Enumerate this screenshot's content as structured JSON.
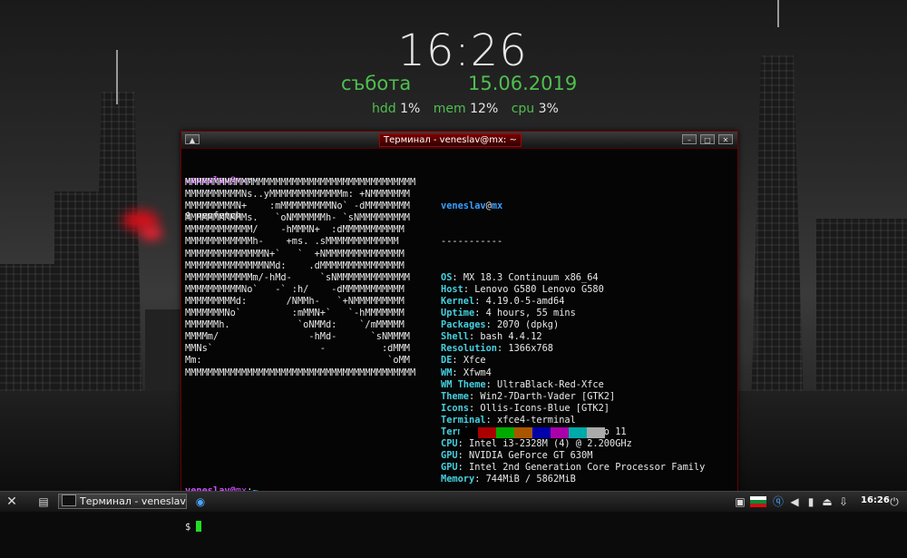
{
  "conky": {
    "time": "16:26",
    "weekday": "събота",
    "date": "15.06.2019",
    "stats": [
      {
        "label": "hdd",
        "value": "1%"
      },
      {
        "label": "mem",
        "value": "12%"
      },
      {
        "label": "cpu",
        "value": "3%"
      }
    ]
  },
  "terminal": {
    "title": "Терминал - veneslav@mx: ~",
    "prompt_user": "veneslav",
    "prompt_host": "mx",
    "prompt_path": "~",
    "command": "neofetch",
    "ascii_art": [
      "MMMMMMMMMMMMMMMMMMMMMMMMMMMMMMMMMMMMMMMMM",
      "MMMMMMMMMMNs..yMMMMMMMMMMMMMm: +NMMMMMMM",
      "MMMMMMMMMN+    :mMMMMMMMMMNo` -dMMMMMMMM",
      "MMMMMMMMMMMs.   `oNMMMMMMh- `sNMMMMMMMMM",
      "MMMMMMMMMMMM/    -hMMMN+  :dMMMMMMMMMMM",
      "MMMMMMMMMMMMh-    +ms. .sMMMMMMMMMMMMM",
      "MMMMMMMMMMMMMMN+`   `  +NMMMMMMMMMMMMMM",
      "MMMMMMMMMMMMMMNMd:    .dMMMMMMMMMMMMMMM",
      "MMMMMMMMMMMMm/-hMd-     `sNMMMMMMMMMMMMM",
      "MMMMMMMMMMNo`   -` :h/    -dMMMMMMMMMMM",
      "MMMMMMMMMd:       /NMMh-   `+NMMMMMMMMM",
      "MMMMMMMNo`         :mMMN+`   `-hMMMMMMM",
      "MMMMMMh.            `oNMMd:    `/mMMMMM",
      "MMMMm/                -hMd-      `sNMMMM",
      "MMNs`                   -          :dMMM",
      "Mm:                                 `oMM",
      "MMMMMMMMMMMMMMMMMMMMMMMMMMMMMMMMMMMMMMMMM"
    ],
    "info_header_user": "veneslav",
    "info_header_host": "mx",
    "separator": "-----------",
    "info": [
      {
        "key": "OS",
        "value": "MX 18.3 Continuum x86_64"
      },
      {
        "key": "Host",
        "value": "Lenovo G580 Lenovo G580"
      },
      {
        "key": "Kernel",
        "value": "4.19.0-5-amd64"
      },
      {
        "key": "Uptime",
        "value": "4 hours, 55 mins"
      },
      {
        "key": "Packages",
        "value": "2070 (dpkg)"
      },
      {
        "key": "Shell",
        "value": "bash 4.4.12"
      },
      {
        "key": "Resolution",
        "value": "1366x768"
      },
      {
        "key": "DE",
        "value": "Xfce"
      },
      {
        "key": "WM",
        "value": "Xfwm4"
      },
      {
        "key": "WM Theme",
        "value": "UltraBlack-Red-Xfce"
      },
      {
        "key": "Theme",
        "value": "Win2-7Darth-Vader [GTK2]"
      },
      {
        "key": "Icons",
        "value": "Ollis-Icons-Blue [GTK2]"
      },
      {
        "key": "Terminal",
        "value": "xfce4-terminal"
      },
      {
        "key": "Terminal Font",
        "value": "Liberation Mono 11"
      },
      {
        "key": "CPU",
        "value": "Intel i3-2328M (4) @ 2.200GHz"
      },
      {
        "key": "GPU",
        "value": "NVIDIA GeForce GT 630M"
      },
      {
        "key": "GPU",
        "value": "Intel 2nd Generation Core Processor Family"
      },
      {
        "key": "Memory",
        "value": "744MiB / 5862MiB"
      }
    ],
    "palette": [
      "#000000",
      "#aa0000",
      "#00aa00",
      "#aa5500",
      "#0000aa",
      "#aa00aa",
      "#00aaaa",
      "#aaaaaa"
    ]
  },
  "taskbar": {
    "task_label": "Терминал - veneslav@...",
    "clock": "16:26",
    "icons": [
      "mx-logo-icon",
      "file-manager-icon",
      "chromium-icon",
      "box-icon",
      "flag-bg-icon",
      "qbittorrent-icon",
      "volume-icon",
      "network-icon",
      "eject-icon",
      "updater-icon",
      "power-icon"
    ]
  }
}
